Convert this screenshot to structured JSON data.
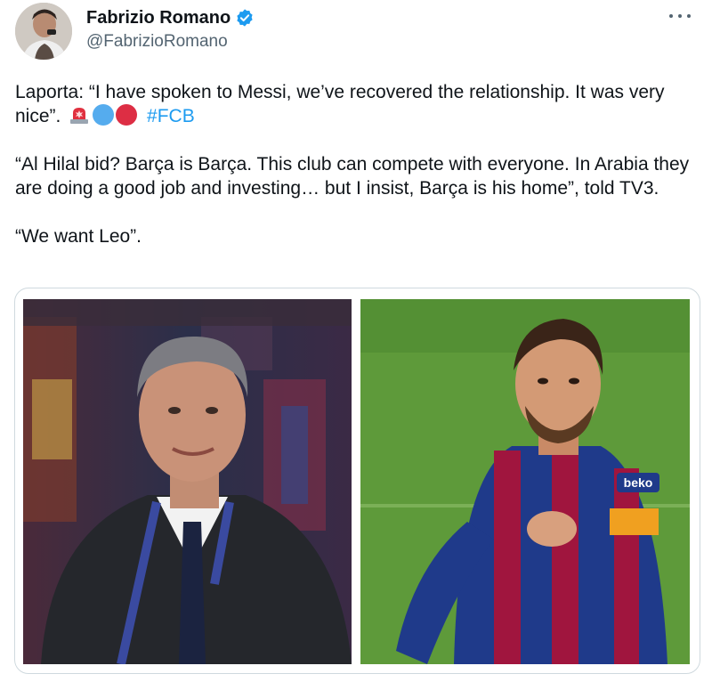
{
  "author": {
    "name": "Fabrizio Romano",
    "handle": "@FabrizioRomano",
    "verified": true,
    "verified_color": "#1d9bf0"
  },
  "icons": {
    "more": "more-options-icon",
    "siren": "rotating-light-emoji",
    "blue": "blue-circle-emoji",
    "red": "red-circle-emoji"
  },
  "tweet": {
    "line1": "Laporta: “I have spoken to Messi, we’ve recovered the relationship. It was very nice”.",
    "hashtag": "#FCB",
    "line2": "“Al Hilal bid? Barça is Barça. This club can compete with everyone. In Arabia they are doing a good job and investing… but I insist, Barça is his home”, told TV3.",
    "line3": "“We want Leo”."
  },
  "media": {
    "left_alt": "photo-of-man-in-suit",
    "right_alt": "photo-of-footballer-pointing",
    "jersey_text": "beko"
  },
  "colors": {
    "link": "#1d9bf0",
    "text": "#0f1419",
    "secondary": "#536471",
    "pitch": "#5e9a3a",
    "blaugrana_blue": "#1f3a8a",
    "blaugrana_red": "#a0153e"
  }
}
